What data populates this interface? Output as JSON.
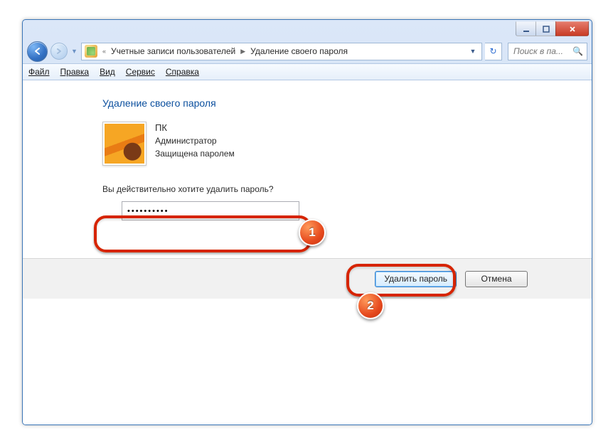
{
  "caption_buttons": {
    "min": "minimize",
    "max": "maximize",
    "close": "close"
  },
  "nav": {
    "crumbs_prefix": "«",
    "crumb1": "Учетные записи пользователей",
    "crumb2": "Удаление своего пароля"
  },
  "search": {
    "placeholder": "Поиск в па..."
  },
  "menu": {
    "file": "Файл",
    "edit": "Правка",
    "view": "Вид",
    "tools": "Сервис",
    "help": "Справка"
  },
  "page": {
    "title": "Удаление своего пароля",
    "user_name": "ПК",
    "user_role": "Администратор",
    "user_prot": "Защищена паролем",
    "prompt": "Вы действительно хотите удалить пароль?",
    "password": "●●●●●●●●●●"
  },
  "buttons": {
    "delete": "Удалить пароль",
    "cancel": "Отмена"
  },
  "annotations": {
    "step1": "1",
    "step2": "2"
  }
}
